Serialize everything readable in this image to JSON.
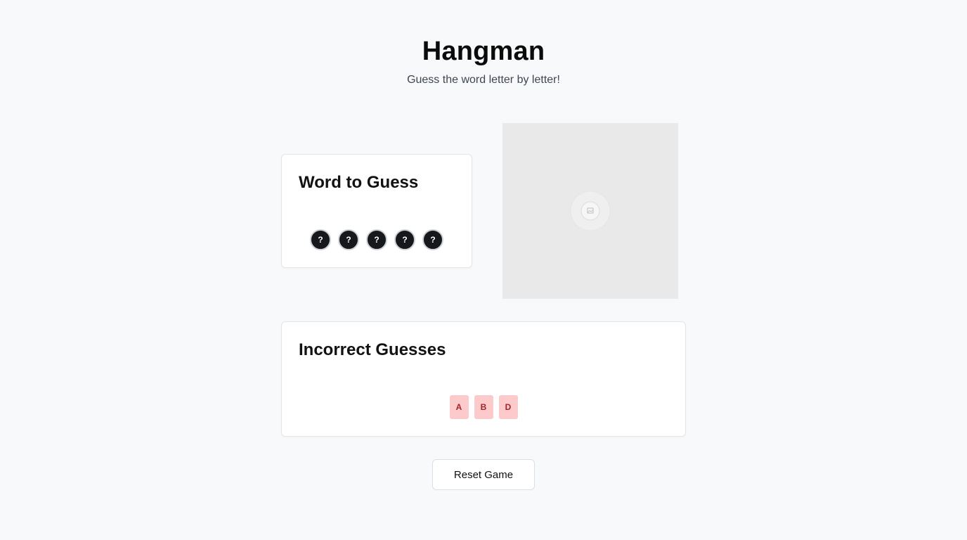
{
  "header": {
    "title": "Hangman",
    "subtitle": "Guess the word letter by letter!"
  },
  "word_card": {
    "title": "Word to Guess",
    "slots": [
      "?",
      "?",
      "?",
      "?",
      "?"
    ]
  },
  "image": {
    "icon": "image-placeholder-icon"
  },
  "incorrect_card": {
    "title": "Incorrect Guesses",
    "letters": [
      "A",
      "B",
      "D"
    ]
  },
  "controls": {
    "reset_label": "Reset Game"
  },
  "colors": {
    "background": "#f8f9fa",
    "slot_fill": "#17181b",
    "wrong_fill": "#fccaca",
    "wrong_text": "#a3242a"
  }
}
